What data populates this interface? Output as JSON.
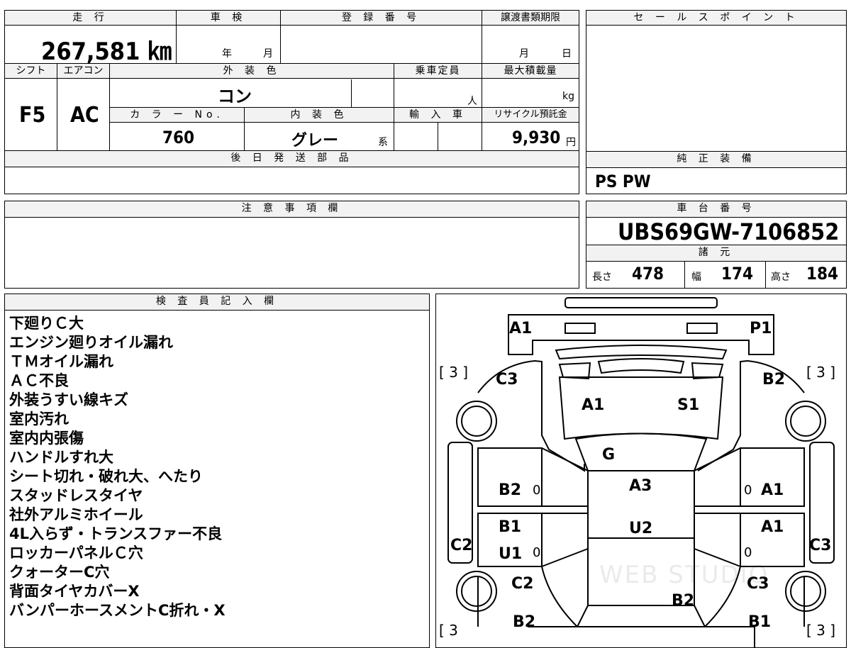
{
  "top": {
    "mileage_label": "走 行",
    "mileage_value": "267,581 ㎞",
    "inspection_label": "車 検",
    "inspection_year": "年",
    "inspection_month": "月",
    "registration_label": "登 録 番 号",
    "transfer_label": "譲渡書類期限",
    "transfer_month": "月",
    "transfer_day": "日",
    "sales_point_label": "セ ー ル ス ポ イ ン ト"
  },
  "row2": {
    "shift_label": "シフト",
    "shift_value": "F5",
    "aircon_label": "エアコン",
    "aircon_value": "AC",
    "exterior_label": "外 装 色",
    "exterior_value": "コン",
    "capacity_label": "乗車定員",
    "capacity_unit": "人",
    "maxload_label": "最大積載量",
    "maxload_unit": "kg",
    "color_no_label": "カ ラ ー No.",
    "color_no_value": "760",
    "interior_label": "内 装 色",
    "interior_value": "グレー",
    "interior_suffix": "系",
    "import_label": "輸 入 車",
    "recycle_label": "リサイクル預託金",
    "recycle_value": "9,930",
    "recycle_unit": "円",
    "later_parts_label": "後 日 発 送 部 品",
    "genuine_label": "純 正 装 備",
    "genuine_value": "PS PW"
  },
  "caution": {
    "label": "注 意 事 項 欄"
  },
  "chassis": {
    "label": "車 台 番 号",
    "value": "UBS69GW-7106852",
    "spec_label": "諸 元",
    "length_label": "長さ",
    "length_value": "478",
    "width_label": "幅",
    "width_value": "174",
    "height_label": "高さ",
    "height_value": "184"
  },
  "inspector": {
    "label": "検 査 員 記 入 欄",
    "notes": [
      "下廻りＣ大",
      "エンジン廻りオイル漏れ",
      "ＴＭオイル漏れ",
      "ＡＣ不良",
      "外装うすい線キズ",
      "室内汚れ",
      "室内内張傷",
      "ハンドルすれ大",
      "シート切れ・破れ大、へたり",
      "スタッドレスタイヤ",
      "社外アルミホイール",
      "4L入らず・トランスファー不良",
      "ロッカーパネルＣ穴",
      "クォーターC穴",
      "背面タイヤカバーX",
      "バンパーホースメントC折れ・X"
    ]
  },
  "diagram": {
    "tire_tl": "[ 3 ]",
    "tire_tr": "[ 3 ]",
    "tire_bl": "[ 3",
    "tire_br": "[ 3 ]",
    "marks": {
      "front_left": "A1",
      "front_right": "P1",
      "fender_left": "C3",
      "fender_right": "B2",
      "hood_left": "A1",
      "hood_right": "S1",
      "windshield": "G",
      "door_fl": "B2",
      "door_fr": "A1",
      "roof_front": "A3",
      "door_rl_top": "B1",
      "door_rl_bottom": "U1",
      "door_rr": "A1",
      "roof_rear": "U2",
      "rocker_left": "C2",
      "rocker_right": "C3",
      "quarter_left": "C2",
      "quarter_right": "C3",
      "back_door": "B2",
      "rear_left": "B2",
      "rear_right": "B1"
    },
    "zeros": "0",
    "watermark": "WEB STUDIO"
  }
}
